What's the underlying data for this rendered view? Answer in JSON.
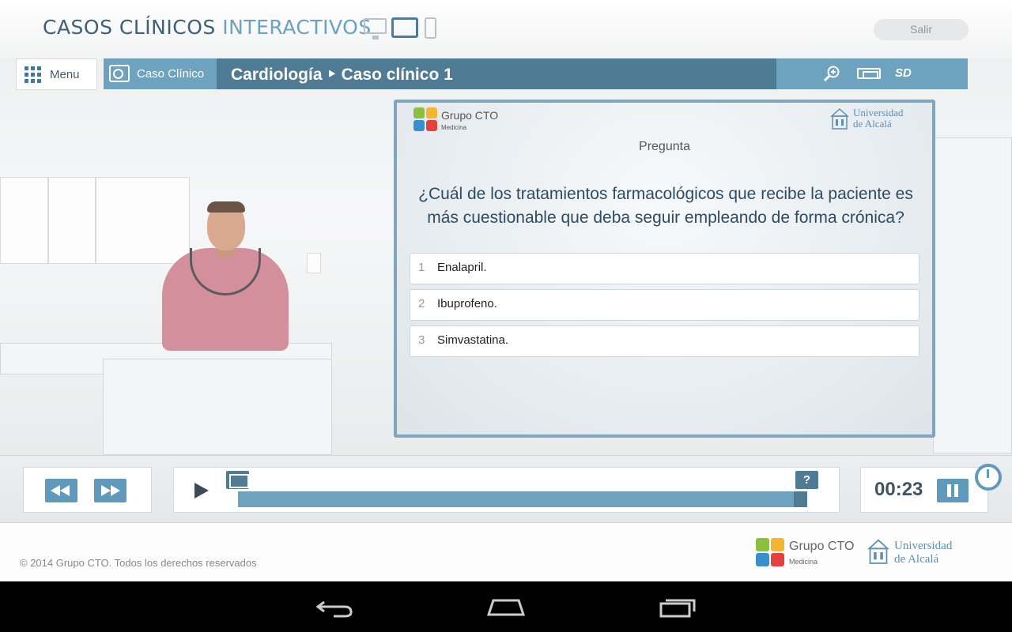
{
  "header": {
    "title_part1": "CASOS CLÍNICOS",
    "title_part2": "INTERACTIVOS",
    "device_icons": [
      "desktop-icon",
      "tablet-icon",
      "phone-icon"
    ],
    "exit_label": "Salir"
  },
  "toolbar": {
    "menu_label": "Menu",
    "case_tab_label": "Caso Clínico",
    "case_title": "Cardiología ‣ Caso clínico 1",
    "quality_label": "SD",
    "accent_color": "#6ea3bf",
    "dark_accent_color": "#4f7b94"
  },
  "question": {
    "brand_name": "Grupo CTO",
    "brand_sub": "Medicina",
    "university_line1": "Universidad",
    "university_line2": "de Alcalá",
    "heading": "Pregunta",
    "text": "¿Cuál de los tratamientos farmacológicos que recibe la paciente es más cuestionable que deba seguir empleando de forma crónica?",
    "answers": [
      {
        "number": "1",
        "text": "Enalapril."
      },
      {
        "number": "2",
        "text": "Ibuprofeno."
      },
      {
        "number": "3",
        "text": "Simvastatina."
      }
    ]
  },
  "player": {
    "question_marker": "?",
    "time": "00:23",
    "progress": 0.98
  },
  "footer": {
    "copyright": "© 2014 Grupo CTO. Todos los derechos reservados",
    "brand_name": "Grupo CTO",
    "brand_sub": "Medicina",
    "university_line1": "Universidad",
    "university_line2": "de Alcalá"
  }
}
